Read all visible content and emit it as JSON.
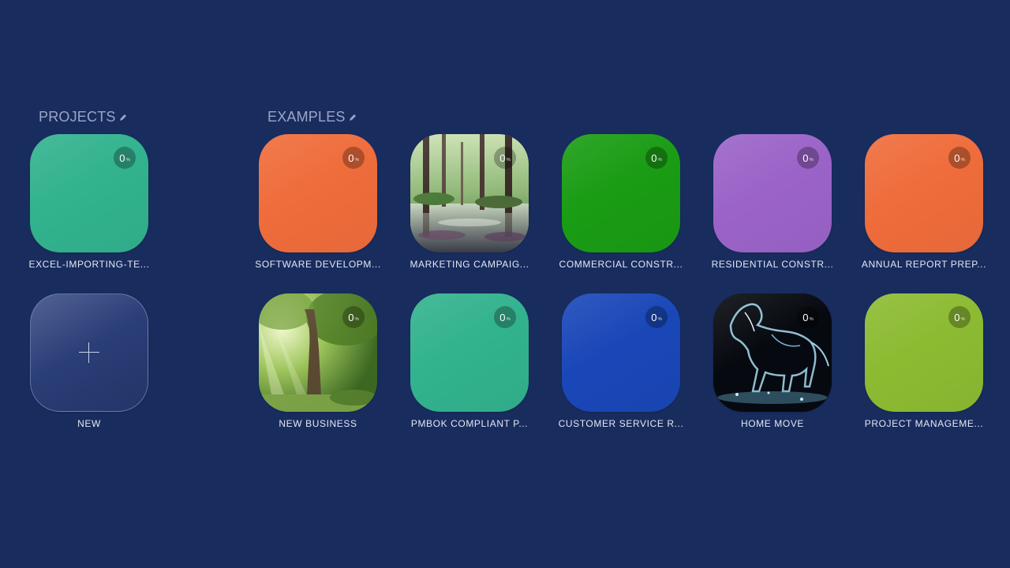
{
  "sections": {
    "projects_title": "PROJECTS",
    "examples_title": "EXAMPLES"
  },
  "projects": [
    {
      "label": "EXCEL-IMPORTING-TE...",
      "progress": "0",
      "unit": "%",
      "color": "#32b28e"
    }
  ],
  "new_tile": {
    "label": "NEW",
    "icon": "plus-icon"
  },
  "examples": [
    {
      "label": "SOFTWARE DEVELOPM...",
      "progress": "0",
      "unit": "%",
      "color": "#ef6c3b"
    },
    {
      "label": "MARKETING CAMPAIG...",
      "progress": "0",
      "unit": "%",
      "image": "swamp-forest-painting"
    },
    {
      "label": "COMMERCIAL CONSTR...",
      "progress": "0",
      "unit": "%",
      "color": "#1a9c14"
    },
    {
      "label": "RESIDENTIAL CONSTR...",
      "progress": "0",
      "unit": "%",
      "color": "#9b63c8"
    },
    {
      "label": "ANNUAL REPORT PREP...",
      "progress": "0",
      "unit": "%",
      "color": "#ef6c3b"
    },
    {
      "label": "NEW BUSINESS",
      "progress": "0",
      "unit": "%",
      "image": "sunlit-forest-photo"
    },
    {
      "label": "PMBOK COMPLIANT P...",
      "progress": "0",
      "unit": "%",
      "color": "#32b28e"
    },
    {
      "label": "CUSTOMER SERVICE R...",
      "progress": "0",
      "unit": "%",
      "color": "#1a47b8"
    },
    {
      "label": "HOME MOVE",
      "progress": "0",
      "unit": "%",
      "image": "water-horse-photo"
    },
    {
      "label": "PROJECT MANAGEME...",
      "progress": "0",
      "unit": "%",
      "color": "#8cbb32"
    }
  ]
}
